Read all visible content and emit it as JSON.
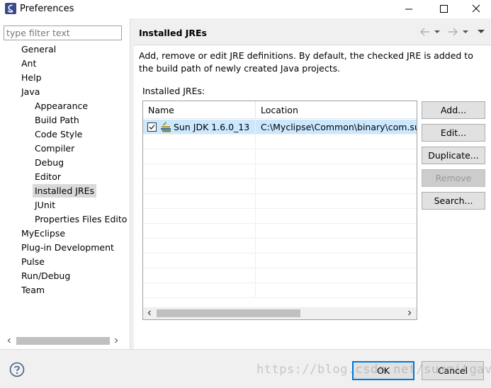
{
  "window": {
    "title": "Preferences"
  },
  "sidebar": {
    "filter_placeholder": "type filter text",
    "items": [
      {
        "label": "General",
        "level": 1
      },
      {
        "label": "Ant",
        "level": 1
      },
      {
        "label": "Help",
        "level": 1
      },
      {
        "label": "Java",
        "level": 1
      },
      {
        "label": "Appearance",
        "level": 2
      },
      {
        "label": "Build Path",
        "level": 2
      },
      {
        "label": "Code Style",
        "level": 2
      },
      {
        "label": "Compiler",
        "level": 2
      },
      {
        "label": "Debug",
        "level": 2
      },
      {
        "label": "Editor",
        "level": 2
      },
      {
        "label": "Installed JREs",
        "level": 2,
        "selected": true
      },
      {
        "label": "JUnit",
        "level": 2
      },
      {
        "label": "Properties Files Edito",
        "level": 2
      },
      {
        "label": "MyEclipse",
        "level": 1
      },
      {
        "label": "Plug-in Development",
        "level": 1
      },
      {
        "label": "Pulse",
        "level": 1
      },
      {
        "label": "Run/Debug",
        "level": 1
      },
      {
        "label": "Team",
        "level": 1
      }
    ]
  },
  "page": {
    "title": "Installed JREs",
    "description": "Add, remove or edit JRE definitions. By default, the checked JRE is added to the build path of newly created Java projects.",
    "table_label": "Installed JREs:",
    "columns": [
      "Name",
      "Location"
    ],
    "rows": [
      {
        "checked": true,
        "name": "Sun JDK 1.6.0_13",
        "location": "C:\\Myclipse\\Common\\binary\\com.sun"
      }
    ],
    "buttons": {
      "add": "Add...",
      "edit": "Edit...",
      "duplicate": "Duplicate...",
      "remove": "Remove",
      "search": "Search..."
    }
  },
  "footer": {
    "ok": "OK",
    "cancel": "Cancel",
    "watermark": "https://blog.csdn.net/summitgava"
  },
  "colors": {
    "selection": "#cce8ff",
    "default_button_border": "#0078d7"
  }
}
